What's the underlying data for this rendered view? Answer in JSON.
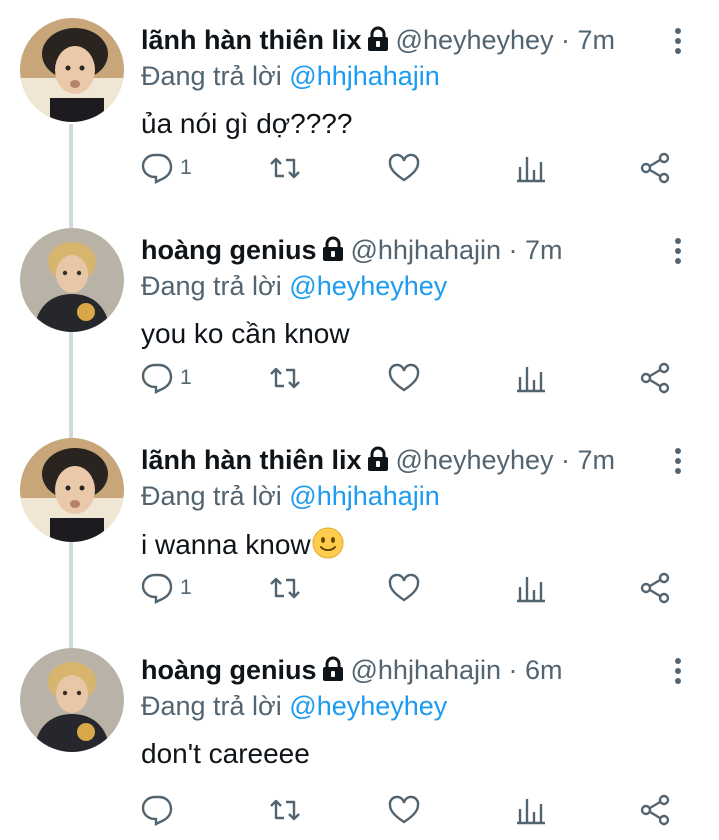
{
  "colors": {
    "text": "#0f1419",
    "muted": "#536471",
    "accent": "#1d9bf0",
    "thread_line": "#cfd9de"
  },
  "tweets": [
    {
      "avatar": "avatar-user-lix",
      "name": "lãnh hàn thiên lix",
      "handle": "@heyheyhey · 7m",
      "reply_prefix": "Đang trả lời",
      "reply_to": "@hhjhahajin",
      "text": "ủa nói gì dợ????",
      "emoji": "",
      "reply_count": "1"
    },
    {
      "avatar": "avatar-user-hoang",
      "name": "hoàng genius",
      "handle": "@hhjhahajin · 7m",
      "reply_prefix": "Đang trả lời",
      "reply_to": "@heyheyhey",
      "text": "you ko cần know",
      "emoji": "",
      "reply_count": "1"
    },
    {
      "avatar": "avatar-user-lix",
      "name": "lãnh hàn thiên lix",
      "handle": "@heyheyhey · 7m",
      "reply_prefix": "Đang trả lời",
      "reply_to": "@hhjhahajin",
      "text": "i wanna know",
      "emoji": "slightly-smiling-face",
      "reply_count": "1"
    },
    {
      "avatar": "avatar-user-hoang",
      "name": "hoàng genius",
      "handle": "@hhjhahajin · 6m",
      "reply_prefix": "Đang trả lời",
      "reply_to": "@heyheyhey",
      "text": "don't careeee",
      "emoji": "",
      "reply_count": ""
    }
  ],
  "icons": [
    "lock-icon",
    "more-icon",
    "reply-icon",
    "retweet-icon",
    "like-icon",
    "views-icon",
    "share-icon"
  ]
}
